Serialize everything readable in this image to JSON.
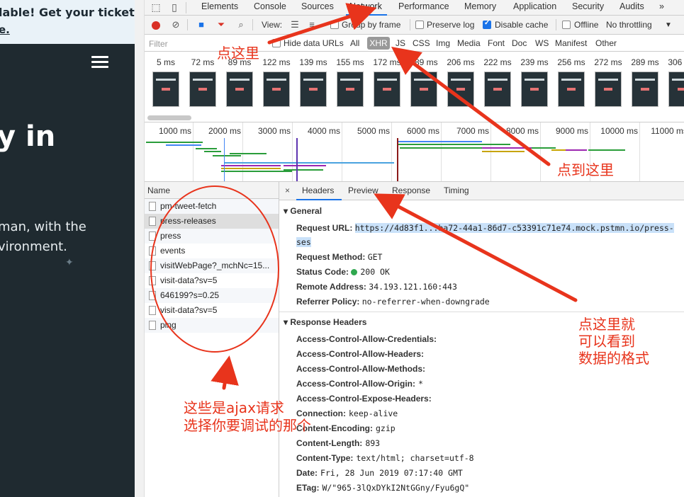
{
  "page": {
    "banner_line1": "lable! Get your tickets",
    "banner_line2": "e.",
    "hero": "y in",
    "sub_line1": "man, with the",
    "sub_line2": "vironment."
  },
  "devtools": {
    "tabs": [
      "Elements",
      "Console",
      "Sources",
      "Network",
      "Performance",
      "Memory",
      "Application",
      "Security",
      "Audits"
    ],
    "more": "»",
    "toolbar": {
      "view_label": "View:",
      "group_by_frame": "Group by frame",
      "preserve_log": "Preserve log",
      "disable_cache": "Disable cache",
      "offline": "Offline",
      "throttling": "No throttling"
    },
    "filter": {
      "placeholder": "Filter",
      "hide_data_urls": "Hide data URLs",
      "types": [
        "All",
        "XHR",
        "JS",
        "CSS",
        "Img",
        "Media",
        "Font",
        "Doc",
        "WS",
        "Manifest",
        "Other"
      ]
    },
    "filmstrip_times": [
      "5 ms",
      "72 ms",
      "89 ms",
      "122 ms",
      "139 ms",
      "155 ms",
      "172 ms",
      "189 ms",
      "206 ms",
      "222 ms",
      "239 ms",
      "256 ms",
      "272 ms",
      "289 ms",
      "306 ms"
    ],
    "overview_ticks": [
      "1000 ms",
      "2000 ms",
      "3000 ms",
      "4000 ms",
      "5000 ms",
      "6000 ms",
      "7000 ms",
      "8000 ms",
      "9000 ms",
      "10000 ms",
      "11000 ms"
    ],
    "requests": {
      "header": "Name",
      "items": [
        "pm-tweet-fetch",
        "press-releases",
        "press",
        "events",
        "visitWebPage?_mchNc=15...",
        "visit-data?sv=5",
        "646199?s=0.25",
        "visit-data?sv=5",
        "ping"
      ]
    },
    "details": {
      "close": "×",
      "tabs": [
        "Headers",
        "Preview",
        "Response",
        "Timing"
      ],
      "general_title": "General",
      "request_url_label": "Request URL:",
      "request_url_line1": "https://4d83f1...ba72-44a1-86d7-c53391c71e74.mock.pstmn.io/press-",
      "request_url_line2": "ses",
      "request_method_label": "Request Method:",
      "request_method": "GET",
      "status_code_label": "Status Code:",
      "status_code": "200 OK",
      "remote_address_label": "Remote Address:",
      "remote_address": "34.193.121.160:443",
      "referrer_policy_label": "Referrer Policy:",
      "referrer_policy": "no-referrer-when-downgrade",
      "response_headers_title": "Response Headers",
      "response_headers": [
        {
          "k": "Access-Control-Allow-Credentials:",
          "v": ""
        },
        {
          "k": "Access-Control-Allow-Headers:",
          "v": ""
        },
        {
          "k": "Access-Control-Allow-Methods:",
          "v": ""
        },
        {
          "k": "Access-Control-Allow-Origin:",
          "v": "*"
        },
        {
          "k": "Access-Control-Expose-Headers:",
          "v": ""
        },
        {
          "k": "Connection:",
          "v": "keep-alive"
        },
        {
          "k": "Content-Encoding:",
          "v": "gzip"
        },
        {
          "k": "Content-Length:",
          "v": "893"
        },
        {
          "k": "Content-Type:",
          "v": "text/html; charset=utf-8"
        },
        {
          "k": "Date:",
          "v": "Fri, 28 Jun 2019 07:17:40 GMT"
        },
        {
          "k": "ETag:",
          "v": "W/\"965-3lQxDYkI2NtGGny/Fyu6gQ\""
        }
      ]
    }
  },
  "annotations": {
    "click_here": "点这里",
    "click_to_here": "点到这里",
    "preview_note_1": "点这里就",
    "preview_note_2": "可以看到",
    "preview_note_3": "数据的格式",
    "ajax_note_1": "这些是ajax请求",
    "ajax_note_2": "选择你要调试的那个"
  },
  "colors": {
    "accent": "#1a73e8",
    "annotation": "#e8341c",
    "record": "#d93025"
  }
}
